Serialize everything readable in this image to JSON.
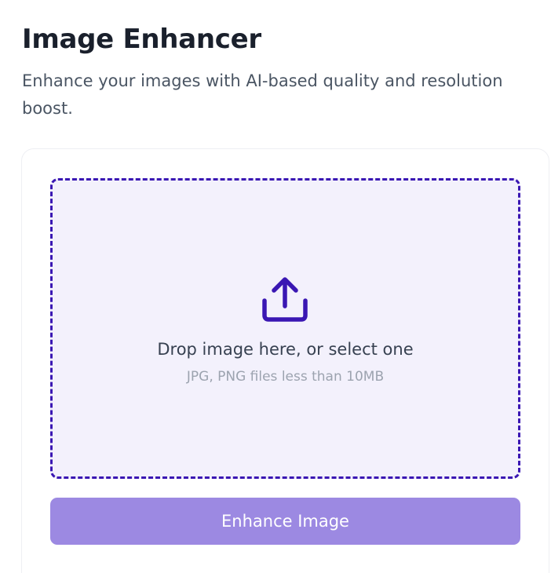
{
  "header": {
    "title": "Image Enhancer",
    "subtitle": "Enhance your images with AI-based quality and resolution boost."
  },
  "upload": {
    "icon": "upload-icon",
    "label": "Drop image here, or select one",
    "hint": "JPG, PNG files less than 10MB"
  },
  "actions": {
    "enhance_label": "Enhance Image"
  },
  "colors": {
    "accent": "#3a17b3",
    "dropzone_bg": "#f3f1fc",
    "button_bg": "#9c89e2",
    "title": "#1a202c",
    "subtitle": "#4a5563"
  }
}
